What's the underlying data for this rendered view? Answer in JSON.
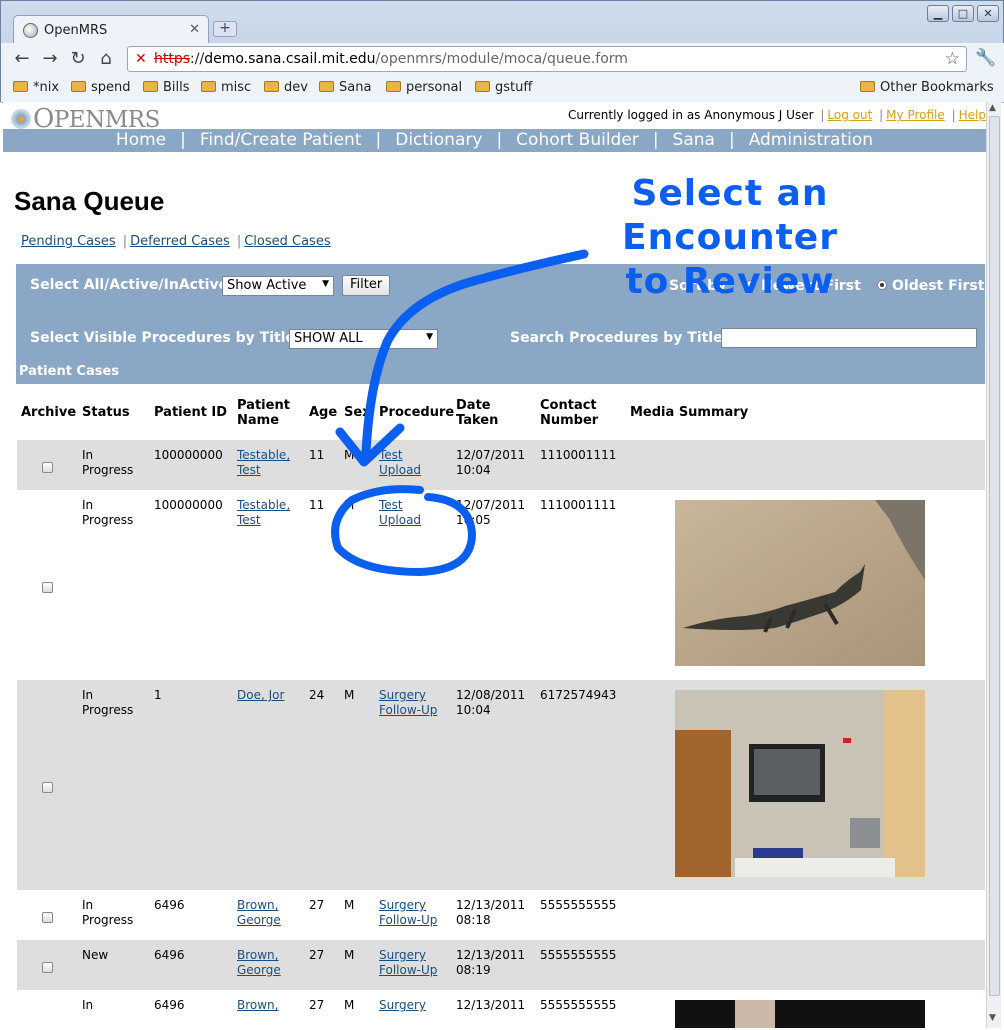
{
  "browser": {
    "tab_title": "OpenMRS",
    "url": {
      "scheme": "https",
      "rest": "://",
      "host": "demo.sana.csail.mit.edu",
      "path": "/openmrs/module/moca/queue.form"
    },
    "bookmarks": [
      "*nix",
      "spend",
      "Bills",
      "misc",
      "dev",
      "Sana",
      "personal",
      "gstuff"
    ],
    "other_bookmarks": "Other Bookmarks"
  },
  "site": {
    "logo_o": "O",
    "logo_rest": "PENMRS",
    "logged_in": "Currently logged in as Anonymous J User",
    "logout": "Log out",
    "my_profile": "My Profile",
    "help": "Help",
    "menu": [
      "Home",
      "Find/Create Patient",
      "Dictionary",
      "Cohort Builder",
      "Sana",
      "Administration"
    ]
  },
  "page": {
    "title": "Sana Queue",
    "case_links": [
      "Pending Cases",
      "Deferred Cases",
      "Closed Cases"
    ]
  },
  "filters": {
    "select_all_label": "Select All/Active/InActive",
    "show_select": "Show Active",
    "filter_button": "Filter",
    "sort_by_label": "Sort by",
    "newest_first": "Newest First",
    "oldest_first": "Oldest First",
    "sort_selected": "Oldest First",
    "procedures_label": "Select Visible Procedures by Title",
    "procedures_select": "SHOW ALL",
    "search_label": "Search Procedures by Title",
    "search_value": "",
    "patient_cases": "Patient Cases"
  },
  "table": {
    "headers": [
      "Archive",
      "Status",
      "Patient ID",
      "Patient Name",
      "Age",
      "Sex",
      "Procedure",
      "Date Taken",
      "Contact Number",
      "Media Summary"
    ],
    "rows": [
      {
        "status": "In Progress",
        "patient_id": "100000000",
        "name": "Testable, Test",
        "age": "11",
        "sex": "M",
        "procedure": "Test Upload",
        "date": "12/07/2011",
        "time": "10:04",
        "contact": "1110001111",
        "media": "none"
      },
      {
        "status": "In Progress",
        "patient_id": "100000000",
        "name": "Testable, Test",
        "age": "11",
        "sex": "M",
        "procedure": "Test Upload",
        "date": "12/07/2011",
        "time": "10:05",
        "contact": "1110001111",
        "media": "iguana-photo"
      },
      {
        "status": "In Progress",
        "patient_id": "1",
        "name": "Doe, Jor",
        "age": "24",
        "sex": "M",
        "procedure": "Surgery Follow-Up",
        "date": "12/08/2011",
        "time": "10:04",
        "contact": "6172574943",
        "media": "room-photo"
      },
      {
        "status": "In Progress",
        "patient_id": "6496",
        "name": "Brown, George",
        "age": "27",
        "sex": "M",
        "procedure": "Surgery Follow-Up",
        "date": "12/13/2011",
        "time": "08:18",
        "contact": "5555555555",
        "media": "none"
      },
      {
        "status": "New",
        "patient_id": "6496",
        "name": "Brown, George",
        "age": "27",
        "sex": "M",
        "procedure": "Surgery Follow-Up",
        "date": "12/13/2011",
        "time": "08:19",
        "contact": "5555555555",
        "media": "none"
      },
      {
        "status": "In",
        "patient_id": "6496",
        "name": "Brown,",
        "age": "27",
        "sex": "M",
        "procedure": "Surgery",
        "date": "12/13/2011",
        "time": "",
        "contact": "5555555555",
        "media": "dark-photo"
      }
    ]
  },
  "annotation": {
    "line1": "Select an Encounter",
    "line2": "to Review",
    "color": "#0a5ff0"
  }
}
